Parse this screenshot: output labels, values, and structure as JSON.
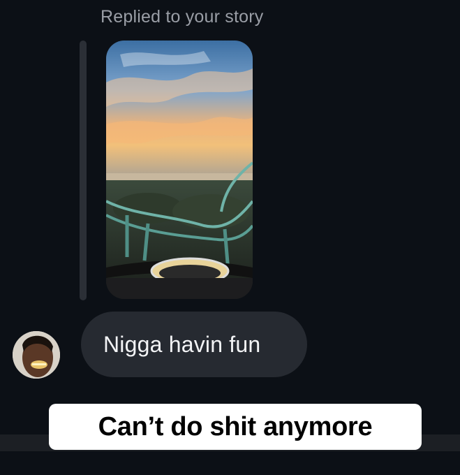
{
  "conversation": {
    "reply_header": "Replied to your story",
    "message": "Nigga havin fun"
  },
  "meme": {
    "caption": "Can’t do shit anymore"
  },
  "colors": {
    "background": "#0c1016",
    "bubble": "#262a31",
    "reply_text": "#9a9ea6"
  }
}
